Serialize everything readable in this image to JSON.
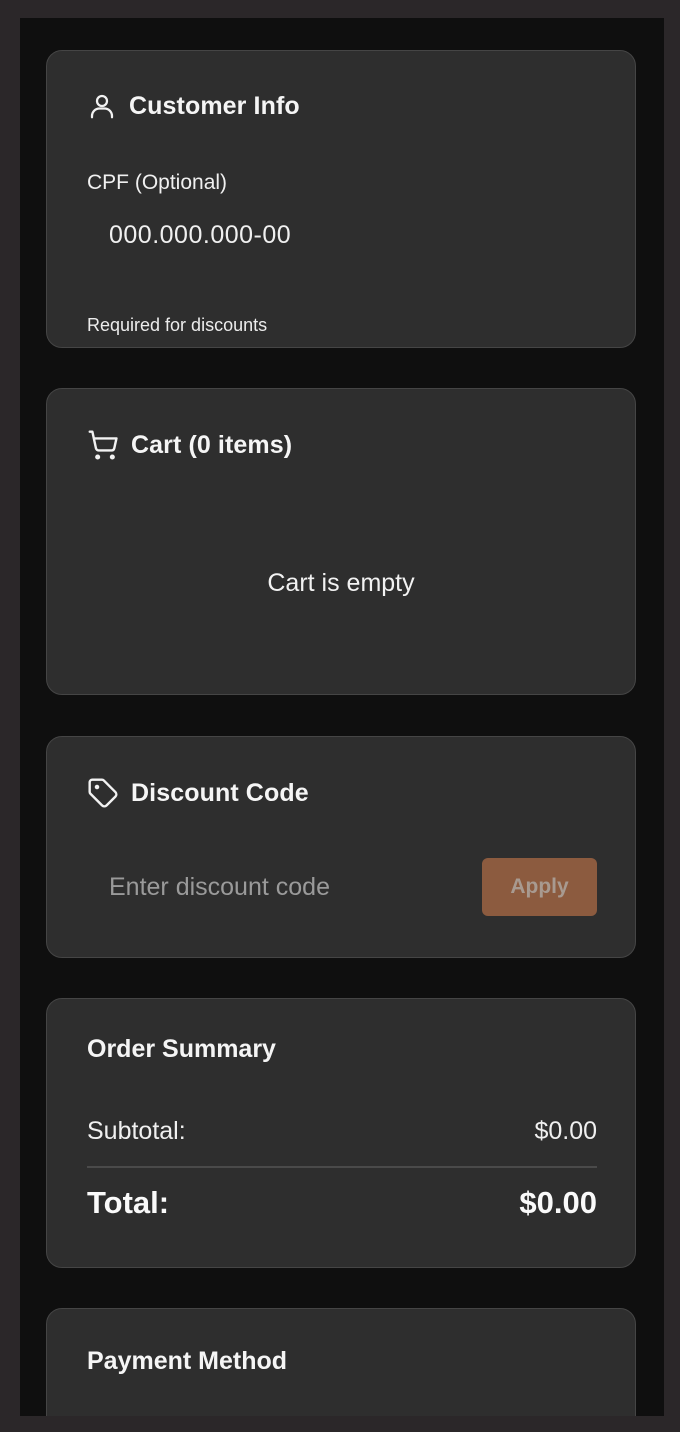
{
  "customer": {
    "title": "Customer Info",
    "icon": "user-icon",
    "cpf_label": "CPF (Optional)",
    "cpf_placeholder": "000.000.000-00",
    "helper": "Required for discounts"
  },
  "cart": {
    "title": "Cart (0 items)",
    "icon": "shopping-cart-icon",
    "empty_message": "Cart is empty"
  },
  "discount": {
    "title": "Discount Code",
    "icon": "tag-icon",
    "placeholder": "Enter discount code",
    "apply_label": "Apply"
  },
  "summary": {
    "title": "Order Summary",
    "subtotal_label": "Subtotal:",
    "subtotal_value": "$0.00",
    "total_label": "Total:",
    "total_value": "$0.00"
  },
  "payment": {
    "title": "Payment Method"
  },
  "colors": {
    "page_background": "#0f0f0f",
    "card_background": "#2e2e2e",
    "accent": "#8c5b3f"
  }
}
